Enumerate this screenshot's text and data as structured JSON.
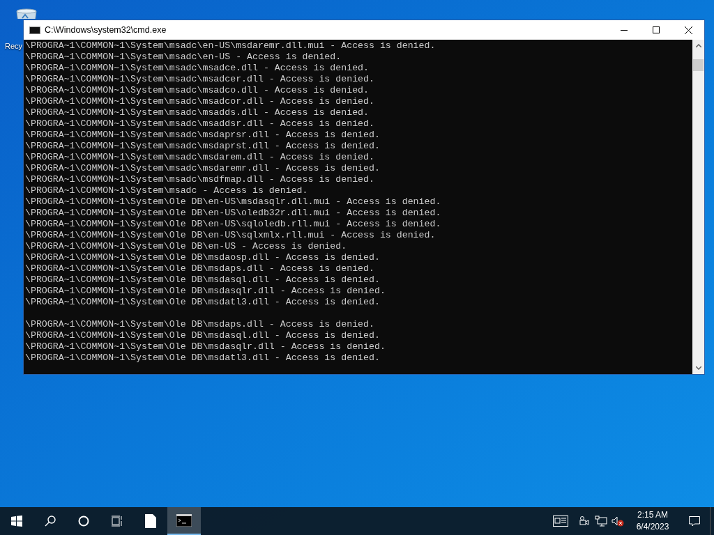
{
  "desktop": {
    "icons": [
      {
        "label": "Recy"
      }
    ]
  },
  "window": {
    "title": "C:\\Windows\\system32\\cmd.exe"
  },
  "console": {
    "lines": [
      {
        "kind": "output",
        "text": "\\PROGRA~1\\COMMON~1\\System\\msadc\\en-US\\msdaremr.dll.mui - Access is denied."
      },
      {
        "kind": "output",
        "text": "\\PROGRA~1\\COMMON~1\\System\\msadc\\en-US - Access is denied."
      },
      {
        "kind": "output",
        "text": "\\PROGRA~1\\COMMON~1\\System\\msadc\\msadce.dll - Access is denied."
      },
      {
        "kind": "output",
        "text": "\\PROGRA~1\\COMMON~1\\System\\msadc\\msadcer.dll - Access is denied."
      },
      {
        "kind": "output",
        "text": "\\PROGRA~1\\COMMON~1\\System\\msadc\\msadco.dll - Access is denied."
      },
      {
        "kind": "output",
        "text": "\\PROGRA~1\\COMMON~1\\System\\msadc\\msadcor.dll - Access is denied."
      },
      {
        "kind": "output",
        "text": "\\PROGRA~1\\COMMON~1\\System\\msadc\\msadds.dll - Access is denied."
      },
      {
        "kind": "output",
        "text": "\\PROGRA~1\\COMMON~1\\System\\msadc\\msaddsr.dll - Access is denied."
      },
      {
        "kind": "output",
        "text": "\\PROGRA~1\\COMMON~1\\System\\msadc\\msdaprsr.dll - Access is denied."
      },
      {
        "kind": "output",
        "text": "\\PROGRA~1\\COMMON~1\\System\\msadc\\msdaprst.dll - Access is denied."
      },
      {
        "kind": "output",
        "text": "\\PROGRA~1\\COMMON~1\\System\\msadc\\msdarem.dll - Access is denied."
      },
      {
        "kind": "output",
        "text": "\\PROGRA~1\\COMMON~1\\System\\msadc\\msdaremr.dll - Access is denied."
      },
      {
        "kind": "output",
        "text": "\\PROGRA~1\\COMMON~1\\System\\msadc\\msdfmap.dll - Access is denied."
      },
      {
        "kind": "output",
        "text": "\\PROGRA~1\\COMMON~1\\System\\msadc - Access is denied."
      },
      {
        "kind": "output",
        "text": "\\PROGRA~1\\COMMON~1\\System\\Ole DB\\en-US\\msdasqlr.dll.mui - Access is denied."
      },
      {
        "kind": "output",
        "text": "\\PROGRA~1\\COMMON~1\\System\\Ole DB\\en-US\\oledb32r.dll.mui - Access is denied."
      },
      {
        "kind": "output",
        "text": "\\PROGRA~1\\COMMON~1\\System\\Ole DB\\en-US\\sqloledb.rll.mui - Access is denied."
      },
      {
        "kind": "output",
        "text": "\\PROGRA~1\\COMMON~1\\System\\Ole DB\\en-US\\sqlxmlx.rll.mui - Access is denied."
      },
      {
        "kind": "output",
        "text": "\\PROGRA~1\\COMMON~1\\System\\Ole DB\\en-US - Access is denied."
      },
      {
        "kind": "output",
        "text": "\\PROGRA~1\\COMMON~1\\System\\Ole DB\\msdaosp.dll - Access is denied."
      },
      {
        "kind": "output",
        "text": "\\PROGRA~1\\COMMON~1\\System\\Ole DB\\msdaps.dll - Access is denied."
      },
      {
        "kind": "output",
        "text": "\\PROGRA~1\\COMMON~1\\System\\Ole DB\\msdasql.dll - Access is denied."
      },
      {
        "kind": "output",
        "text": "\\PROGRA~1\\COMMON~1\\System\\Ole DB\\msdasqlr.dll - Access is denied."
      },
      {
        "kind": "output",
        "text": "\\PROGRA~1\\COMMON~1\\System\\Ole DB\\msdatl3.dll - Access is denied."
      },
      {
        "kind": "blank"
      },
      {
        "kind": "output",
        "text": "\\PROGRA~1\\COMMON~1\\System\\Ole DB\\msdaps.dll - Access is denied."
      },
      {
        "kind": "output",
        "text": "\\PROGRA~1\\COMMON~1\\System\\Ole DB\\msdasql.dll - Access is denied."
      },
      {
        "kind": "output",
        "text": "\\PROGRA~1\\COMMON~1\\System\\Ole DB\\msdasqlr.dll - Access is denied."
      },
      {
        "kind": "output",
        "text": "\\PROGRA~1\\COMMON~1\\System\\Ole DB\\msdatl3.dll - Access is denied."
      }
    ]
  },
  "taskbar": {
    "apps": [
      {
        "kind": "file",
        "selected": false
      },
      {
        "kind": "console",
        "selected": true
      }
    ],
    "clock": {
      "time": "2:15 AM",
      "date": "6/4/2023"
    }
  }
}
